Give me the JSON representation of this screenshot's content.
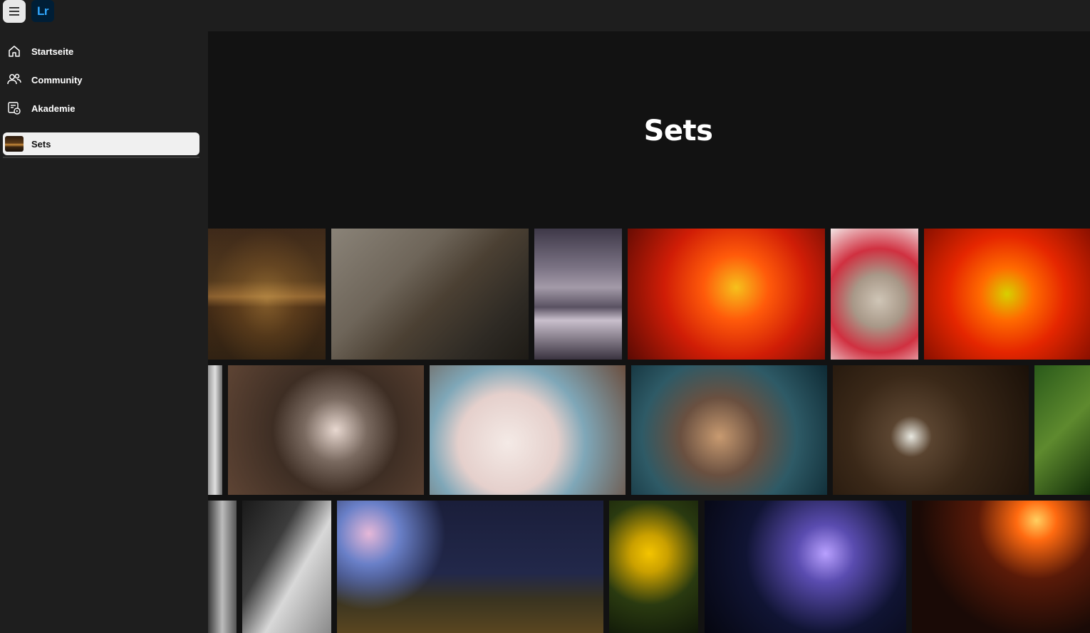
{
  "app": {
    "logo_text": "Lr",
    "accent_color": "#31a8ff",
    "logo_bg": "#001e36"
  },
  "sidebar": {
    "items": [
      {
        "label": "Startseite",
        "icon": "home-icon"
      },
      {
        "label": "Community",
        "icon": "people-icon"
      },
      {
        "label": "Akademie",
        "icon": "academy-icon"
      }
    ],
    "active_item": {
      "label": "Sets",
      "icon": "set-thumbnail"
    }
  },
  "hero": {
    "title": "Sets"
  },
  "gallery": {
    "rows": [
      [
        "night-city-river-photo",
        "plover-bird-photo",
        "swan-lake-photo",
        "red-poppy-photo",
        "cherub-statue-photo",
        "poppy-closeup-photo"
      ],
      [
        "black-white-partial-photo",
        "tamarin-monkey-photo",
        "pelican-photo",
        "lemur-photo",
        "white-flower-photo",
        "green-foliage-photo"
      ],
      [
        "black-white-structure-photo",
        "bridge-underside-photo",
        "fireworks-photo",
        "yellow-flowers-photo",
        "illuminated-city-photo",
        "fire-show-photo"
      ]
    ]
  }
}
